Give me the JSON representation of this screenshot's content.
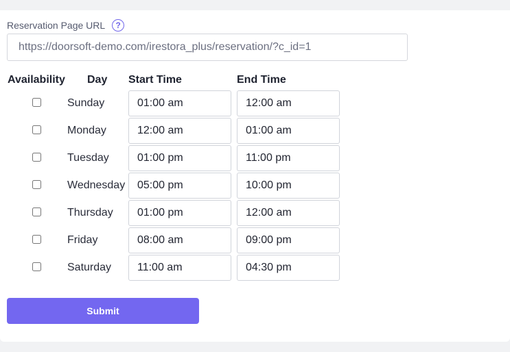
{
  "form": {
    "url_label": "Reservation Page URL",
    "help_glyph": "?",
    "url_value": "https://doorsoft-demo.com/irestora_plus/reservation/?c_id=1",
    "columns": {
      "availability": "Availability",
      "day": "Day",
      "start": "Start Time",
      "end": "End Time"
    },
    "rows": [
      {
        "day": "Sunday",
        "start": "01:00 am",
        "end": "12:00 am",
        "available": false
      },
      {
        "day": "Monday",
        "start": "12:00 am",
        "end": "01:00 am",
        "available": false
      },
      {
        "day": "Tuesday",
        "start": "01:00 pm",
        "end": "11:00 pm",
        "available": false
      },
      {
        "day": "Wednesday",
        "start": "05:00 pm",
        "end": "10:00 pm",
        "available": false
      },
      {
        "day": "Thursday",
        "start": "01:00 pm",
        "end": "12:00 am",
        "available": false
      },
      {
        "day": "Friday",
        "start": "08:00 am",
        "end": "09:00 pm",
        "available": false
      },
      {
        "day": "Saturday",
        "start": "11:00 am",
        "end": "04:30 pm",
        "available": false
      }
    ],
    "submit_label": "Submit"
  },
  "colors": {
    "accent": "#7367f0",
    "help_icon": "#7065ea",
    "page_bg": "#f1f2f4",
    "card_bg": "#ffffff"
  },
  "icons": {
    "help": "question-circle-icon"
  }
}
